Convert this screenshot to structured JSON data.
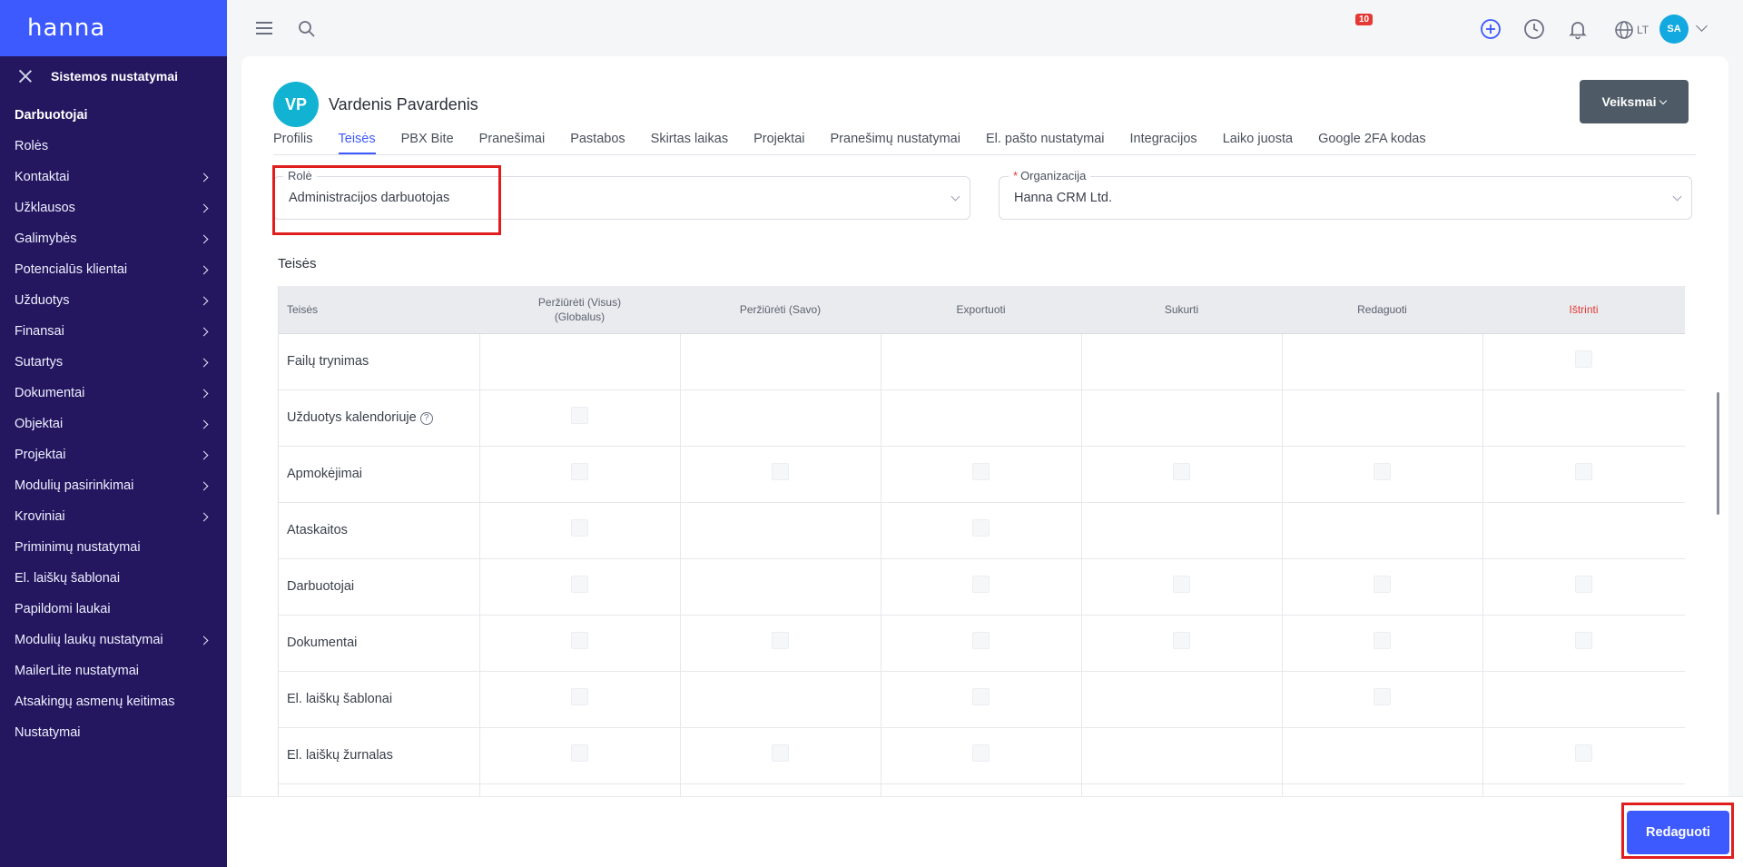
{
  "brand": "hanna",
  "sidebar": {
    "section_title": "Sistemos nustatymai",
    "items": [
      {
        "label": "Darbuotojai",
        "active": true,
        "has_children": false
      },
      {
        "label": "Rolės",
        "has_children": false
      },
      {
        "label": "Kontaktai",
        "has_children": true
      },
      {
        "label": "Užklausos",
        "has_children": true
      },
      {
        "label": "Galimybės",
        "has_children": true
      },
      {
        "label": "Potencialūs klientai",
        "has_children": true
      },
      {
        "label": "Užduotys",
        "has_children": true
      },
      {
        "label": "Finansai",
        "has_children": true
      },
      {
        "label": "Sutartys",
        "has_children": true
      },
      {
        "label": "Dokumentai",
        "has_children": true
      },
      {
        "label": "Objektai",
        "has_children": true
      },
      {
        "label": "Projektai",
        "has_children": true
      },
      {
        "label": "Modulių pasirinkimai",
        "has_children": true
      },
      {
        "label": "Kroviniai",
        "has_children": true
      },
      {
        "label": "Priminimų nustatymai",
        "has_children": false
      },
      {
        "label": "El. laiškų šablonai",
        "has_children": false
      },
      {
        "label": "Papildomi laukai",
        "has_children": false
      },
      {
        "label": "Modulių laukų nustatymai",
        "has_children": true
      },
      {
        "label": "MailerLite nustatymai",
        "has_children": false
      },
      {
        "label": "Atsakingų asmenų keitimas",
        "has_children": false
      },
      {
        "label": "Nustatymai",
        "has_children": false
      }
    ]
  },
  "topbar": {
    "notification_count": "10",
    "language": "LT",
    "user_initials": "SA",
    "accent_color": "#3d5afe"
  },
  "profile": {
    "initials": "VP",
    "name": "Vardenis Pavardenis",
    "actions_label": "Veiksmai"
  },
  "tabs": [
    {
      "label": "Profilis"
    },
    {
      "label": "Teisės",
      "active": true
    },
    {
      "label": "PBX Bite"
    },
    {
      "label": "Pranešimai"
    },
    {
      "label": "Pastabos"
    },
    {
      "label": "Skirtas laikas"
    },
    {
      "label": "Projektai"
    },
    {
      "label": "Pranešimų nustatymai"
    },
    {
      "label": "El. pašto nustatymai"
    },
    {
      "label": "Integracijos"
    },
    {
      "label": "Laiko juosta"
    },
    {
      "label": "Google 2FA kodas"
    }
  ],
  "form": {
    "role_label": "Rolė",
    "role_value": "Administracijos darbuotojas",
    "org_label": "Organizacija",
    "org_required_mark": "*",
    "org_value": "Hanna CRM Ltd."
  },
  "permissions": {
    "title": "Teisės",
    "columns": [
      "Teisės",
      "Peržiūrėti (Visus) (Globalus)",
      "Peržiūrėti (Savo)",
      "Exportuoti",
      "Sukurti",
      "Redaguoti",
      "Ištrinti"
    ],
    "rows": [
      {
        "name": "Failų trynimas",
        "checks": [
          false,
          false,
          false,
          false,
          false,
          true
        ]
      },
      {
        "name": "Užduotys kalendoriuje",
        "help": true,
        "checks": [
          true,
          false,
          false,
          false,
          false,
          false
        ]
      },
      {
        "name": "Apmokėjimai",
        "checks": [
          true,
          true,
          true,
          true,
          true,
          true
        ]
      },
      {
        "name": "Ataskaitos",
        "checks": [
          true,
          false,
          true,
          false,
          false,
          false
        ]
      },
      {
        "name": "Darbuotojai",
        "checks": [
          true,
          false,
          true,
          true,
          true,
          true
        ]
      },
      {
        "name": "Dokumentai",
        "checks": [
          true,
          true,
          true,
          true,
          true,
          true
        ]
      },
      {
        "name": "El. laiškų šablonai",
        "checks": [
          true,
          false,
          true,
          false,
          true,
          false
        ]
      },
      {
        "name": "El. laiškų žurnalas",
        "checks": [
          true,
          true,
          true,
          false,
          false,
          true
        ]
      },
      {
        "name": "",
        "checks": [
          false,
          false,
          false,
          false,
          false,
          false
        ]
      }
    ]
  },
  "footer": {
    "edit_label": "Redaguoti"
  }
}
